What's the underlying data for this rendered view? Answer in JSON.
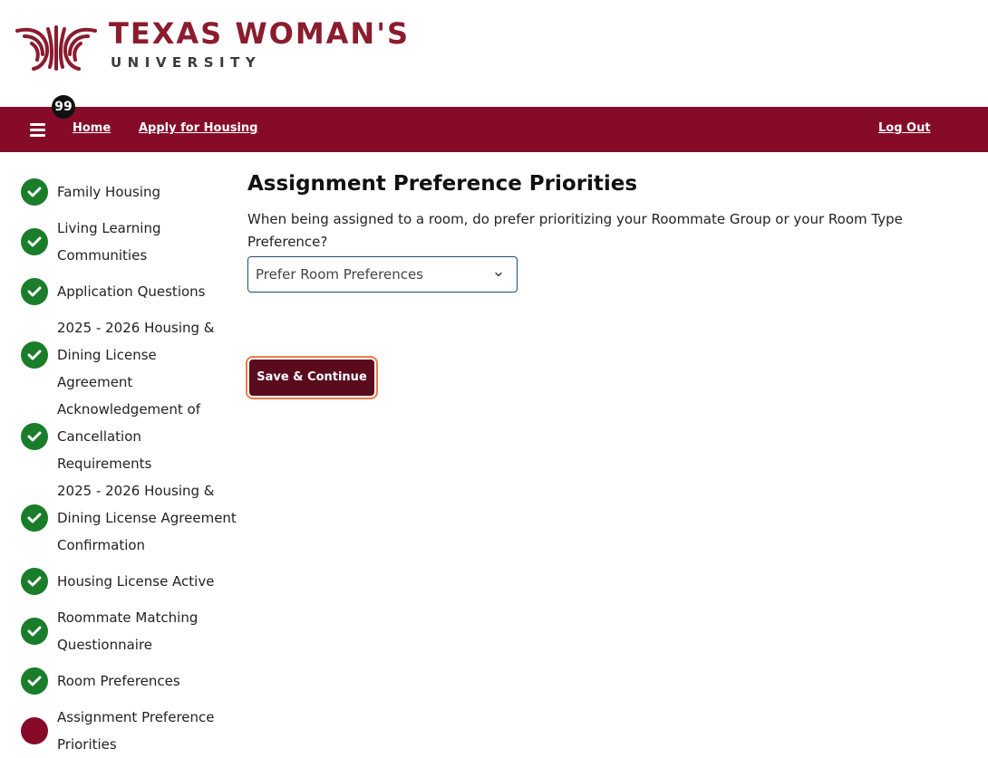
{
  "brand": {
    "name": "TEXAS WOMAN'S",
    "subname": "UNIVERSITY",
    "primary_color": "#860b29",
    "logo_color": "#8a1c2e"
  },
  "nav": {
    "menu_icon": "hamburger-menu-icon",
    "badge_count": "99",
    "home_label": "Home",
    "apply_label": "Apply for Housing",
    "logout_label": "Log Out"
  },
  "sidebar": {
    "complete_color": "#1a7d2a",
    "current_color": "#860b29",
    "items": [
      {
        "label": "Family Housing",
        "status": "complete",
        "icon": "check-circle-icon"
      },
      {
        "label": "Living Learning Communities",
        "status": "complete",
        "icon": "check-circle-icon"
      },
      {
        "label": "Application Questions",
        "status": "complete",
        "icon": "check-circle-icon"
      },
      {
        "label": "2025 - 2026 Housing & Dining License Agreement",
        "status": "complete",
        "icon": "check-circle-icon"
      },
      {
        "label": "Acknowledgement of Cancellation Requirements",
        "status": "complete",
        "icon": "check-circle-icon"
      },
      {
        "label": "2025 - 2026 Housing & Dining License Agreement Confirmation",
        "status": "complete",
        "icon": "check-circle-icon"
      },
      {
        "label": "Housing License Active",
        "status": "complete",
        "icon": "check-circle-icon"
      },
      {
        "label": "Roommate Matching Questionnaire",
        "status": "complete",
        "icon": "check-circle-icon"
      },
      {
        "label": "Room Preferences",
        "status": "complete",
        "icon": "check-circle-icon"
      },
      {
        "label": "Assignment Preference Priorities",
        "status": "current",
        "icon": "current-step-circle-icon"
      }
    ]
  },
  "main": {
    "title": "Assignment Preference Priorities",
    "question": "When being assigned to a room, do prefer prioritizing your Roommate Group or your Room Type Preference?",
    "select": {
      "value": "Prefer Room Preferences",
      "icon": "chevron-down-icon"
    },
    "save_label": "Save & Continue"
  }
}
